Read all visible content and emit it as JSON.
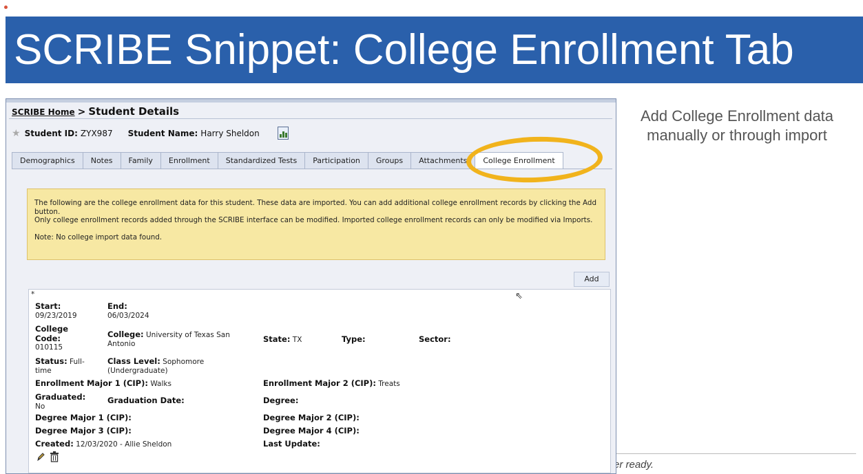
{
  "slide": {
    "title": "SCRIBE Snippet: College Enrollment Tab",
    "side_note": "Add College Enrollment data manually or through import",
    "bottom_fragment": "er ready."
  },
  "breadcrumb": {
    "home_link": "SCRIBE Home",
    "separator": ">",
    "current": "Student Details"
  },
  "student": {
    "id_label": "Student ID:",
    "id_value": "ZYX987",
    "name_label": "Student Name:",
    "name_value": "Harry Sheldon"
  },
  "tabs": [
    {
      "label": "Demographics",
      "active": false
    },
    {
      "label": "Notes",
      "active": false
    },
    {
      "label": "Family",
      "active": false
    },
    {
      "label": "Enrollment",
      "active": false
    },
    {
      "label": "Standardized Tests",
      "active": false
    },
    {
      "label": "Participation",
      "active": false
    },
    {
      "label": "Groups",
      "active": false
    },
    {
      "label": "Attachments",
      "active": false
    },
    {
      "label": "College Enrollment",
      "active": true
    }
  ],
  "notice": {
    "line1": "The following are the college enrollment data for this student. These data are imported.  You can add additional college enrollment records by clicking the Add button.",
    "line2": "Only college enrollment records added through the SCRIBE interface can be modified. Imported college enrollment records can only be modified via Imports.",
    "line3": "Note: No college import data found."
  },
  "add_button": "Add",
  "record": {
    "asterisk": "*",
    "start_label": "Start:",
    "start_value": "09/23/2019",
    "end_label": "End:",
    "end_value": "06/03/2024",
    "college_code_label": "College Code:",
    "college_code_value": "010115",
    "college_label": "College:",
    "college_value": "University of Texas San Antonio",
    "state_label": "State:",
    "state_value": "TX",
    "type_label": "Type:",
    "type_value": "",
    "sector_label": "Sector:",
    "sector_value": "",
    "status_label": "Status:",
    "status_value": "Full-time",
    "class_level_label": "Class Level:",
    "class_level_value": "Sophomore (Undergraduate)",
    "enroll_major1_label": "Enrollment Major 1 (CIP):",
    "enroll_major1_value": "Walks",
    "enroll_major2_label": "Enrollment Major 2 (CIP):",
    "enroll_major2_value": "Treats",
    "graduated_label": "Graduated:",
    "graduated_value": "No",
    "graduation_date_label": "Graduation Date:",
    "degree_label": "Degree:",
    "degree_major1_label": "Degree Major 1 (CIP):",
    "degree_major2_label": "Degree Major 2 (CIP):",
    "degree_major3_label": "Degree Major 3 (CIP):",
    "degree_major4_label": "Degree Major 4 (CIP):",
    "created_label": "Created:",
    "created_value": "12/03/2020 - Allie Sheldon",
    "last_update_label": "Last Update:"
  },
  "icons": {
    "star": "star-icon",
    "report": "report-icon",
    "edit": "pencil-icon",
    "delete": "trash-icon",
    "cursor": "mouse-cursor-icon",
    "highlight": "highlight-circle"
  },
  "colors": {
    "banner": "#2a60ab",
    "notice_bg": "#f7e8a3",
    "highlight_ring": "#f1b31c"
  }
}
